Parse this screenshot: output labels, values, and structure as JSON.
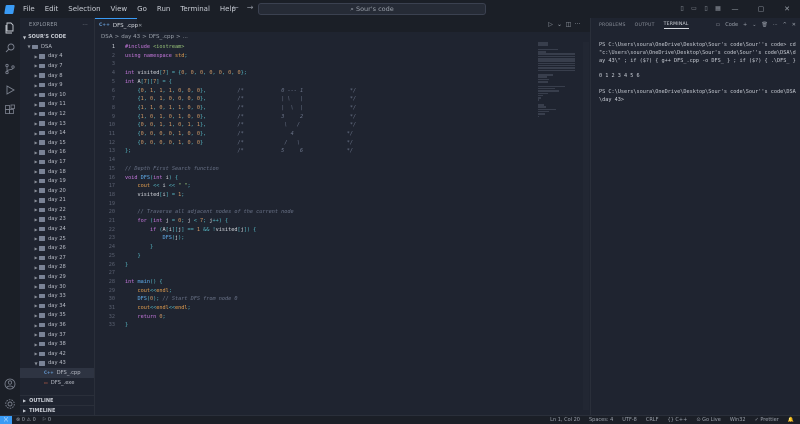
{
  "window": {
    "menu": [
      "File",
      "Edit",
      "Selection",
      "View",
      "Go",
      "Run",
      "Terminal",
      "Help"
    ],
    "search": "Sour's code"
  },
  "sidebar": {
    "title": "EXPLORER",
    "workspace": "SOUR'S CODE",
    "root": "DSA",
    "folders": [
      "day 4",
      "day 7",
      "day 8",
      "day 9",
      "day 10",
      "day 11",
      "day 12",
      "day 13",
      "day 14",
      "day 15",
      "day 16",
      "day 17",
      "day 18",
      "day 19",
      "day 20",
      "day 21",
      "day 22",
      "day 23",
      "day 24",
      "day 25",
      "day 26",
      "day 27",
      "day 28",
      "day 29",
      "day 30",
      "day 33",
      "day 34",
      "day 35",
      "day 36",
      "day 37",
      "day 38",
      "day 42",
      "day 43"
    ],
    "files": [
      {
        "name": "DFS_.cpp",
        "icon": "C++",
        "color": "#659ad2"
      },
      {
        "name": "DFS_.exe",
        "icon": "▭",
        "color": "#e06c4c"
      }
    ],
    "outline": "OUTLINE",
    "timeline": "TIMELINE"
  },
  "editor": {
    "tab": "DFS_.cpp",
    "breadcrumb": [
      "DSA",
      ">",
      "day 43",
      ">",
      "DFS_.cpp",
      ">",
      "..."
    ]
  },
  "code": [
    "#include <iostream>",
    "using namespace std;",
    "",
    "int visited[7] = {0, 0, 0, 0, 0, 0, 0};",
    "int A[7][7] = {",
    "    {0, 1, 1, 1, 0, 0, 0},          /*            0 --- 1               */",
    "    {1, 0, 1, 0, 0, 0, 0},          /*            | \\   |               */",
    "    {1, 1, 0, 1, 1, 0, 0},          /*            |  \\  |               */",
    "    {1, 0, 1, 0, 1, 0, 0},          /*            3     2               */",
    "    {0, 0, 1, 1, 0, 1, 1},          /*             \\   /                */",
    "    {0, 0, 0, 0, 1, 0, 0},          /*               4                 */",
    "    {0, 0, 0, 0, 1, 0, 0}           /*             /   \\               */",
    "};                                  /*            5     6              */",
    "",
    "// Depth First Search function",
    "void DFS(int i) {",
    "    cout << i << \" \";",
    "    visited[i] = 1;",
    "",
    "    // Traverse all adjacent nodes of the current node",
    "    for (int j = 0; j < 7; j++) {",
    "        if (A[i][j] == 1 && !visited[j]) {",
    "            DFS(j);",
    "        }",
    "    }",
    "}",
    "",
    "int main() {",
    "    cout<<endl;",
    "    DFS(0); // Start DFS from node 0",
    "    cout<<endl<<endl;",
    "    return 0;",
    "}"
  ],
  "panel": {
    "tabs": [
      "PROBLEMS",
      "OUTPUT",
      "TERMINAL"
    ],
    "active_tab": "TERMINAL",
    "terminal_name": "Code",
    "terminal": [
      "PS C:\\Users\\soura\\OneDrive\\Desktop\\Sour's code\\Sour''s code> cd \"c:\\Users\\soura\\OneDrive\\Desktop\\Sour's code\\Sour''s code\\DSA\\day 43\\\" ; if ($?) { g++ DFS_.cpp -o DFS_ } ; if ($?) { .\\DFS_ }",
      "",
      "0 1 2 3 4 5 6",
      "",
      "PS C:\\Users\\soura\\OneDrive\\Desktop\\Sour's code\\Sour''s code\\DSA\\day 43>"
    ]
  },
  "status": {
    "left": [
      "⊗ 0 ⚠ 0",
      "⚐ 0"
    ],
    "right": [
      "Ln 1, Col 20",
      "Spaces: 4",
      "UTF-8",
      "CRLF",
      "{} C++",
      "⊙ Go Live",
      "Win32",
      "✓ Prettier",
      "🔔"
    ]
  },
  "colors": {
    "accent": "#3a9bf5",
    "bg": "#1f2430"
  }
}
